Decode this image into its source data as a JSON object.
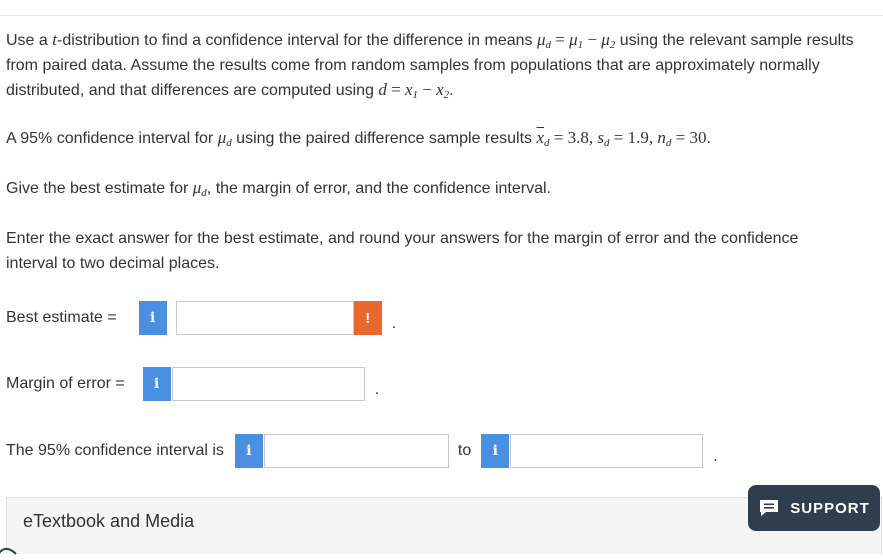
{
  "question": {
    "intro_part1": "Use a ",
    "intro_t": "t",
    "intro_part2": "-distribution to find a confidence interval for the difference in means ",
    "intro_part3": " using the relevant sample results from paired data. Assume the results come from random samples from populations that are approximately normally distributed, and that differences are computed using ",
    "intro_part4": ".",
    "ci_sentence_part1": "A 95% confidence interval for ",
    "ci_sentence_part2": " using the paired difference sample results ",
    "ci_sentence_part3": ".",
    "give_part1": "Give the best estimate for ",
    "give_part2": ", the margin of error, and the confidence interval.",
    "enter_text": "Enter the exact answer for the best estimate, and round your answers for the margin of error and the confidence interval to two decimal places."
  },
  "math": {
    "mu": "μ",
    "d": "d",
    "sub1": "1",
    "sub2": "2",
    "eq": " = ",
    "minus": " − ",
    "x": "x",
    "s": "s",
    "n": "n",
    "comma": ", ",
    "xbar_value": "3.8",
    "s_value": "1.9",
    "n_value": "30"
  },
  "form": {
    "best_estimate_label": "Best estimate =",
    "best_estimate_value": "",
    "warning_glyph": "!",
    "margin_label": "Margin of error =",
    "margin_value": "",
    "interval_label": "The 95% confidence interval is",
    "interval_low_value": "",
    "to_label": "to",
    "interval_high_value": "",
    "info_glyph": "i",
    "period": "."
  },
  "footer": {
    "etextbook_label": "eTextbook and Media",
    "support_label": "SUPPORT"
  },
  "colors": {
    "info_button": "#4a90e2",
    "warning": "#e8682e",
    "support_bg": "#2f3d4f"
  }
}
